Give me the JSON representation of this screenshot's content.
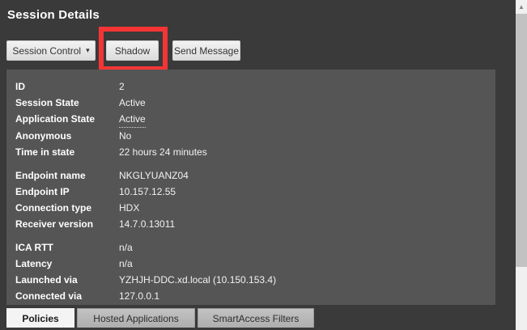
{
  "page": {
    "title": "Session Details"
  },
  "toolbar": {
    "session_control_label": "Session Control",
    "session_control_caret": "▾",
    "shadow_label": "Shadow",
    "send_message_label": "Send Message"
  },
  "annotation": {
    "shape": "red-highlight-rectangle",
    "color": "#f53535",
    "target": "shadow-button"
  },
  "details": {
    "groups": [
      {
        "rows": [
          {
            "label": "ID",
            "value": "2"
          },
          {
            "label": "Session State",
            "value": "Active"
          },
          {
            "label": "Application State",
            "value": "Active",
            "underlined": true
          },
          {
            "label": "Anonymous",
            "value": "No"
          },
          {
            "label": "Time in state",
            "value": "22 hours 24 minutes"
          }
        ]
      },
      {
        "rows": [
          {
            "label": "Endpoint name",
            "value": "NKGLYUANZ04"
          },
          {
            "label": "Endpoint IP",
            "value": "10.157.12.55"
          },
          {
            "label": "Connection type",
            "value": "HDX"
          },
          {
            "label": "Receiver version",
            "value": "14.7.0.13011"
          }
        ]
      },
      {
        "rows": [
          {
            "label": "ICA RTT",
            "value": "n/a"
          },
          {
            "label": "Latency",
            "value": "n/a"
          },
          {
            "label": "Launched via",
            "value": "YZHJH-DDC.xd.local (10.150.153.4)"
          },
          {
            "label": "Connected via",
            "value": "127.0.0.1"
          }
        ]
      }
    ]
  },
  "tabs": [
    {
      "label": "Policies",
      "active": true
    },
    {
      "label": "Hosted Applications",
      "active": false
    },
    {
      "label": "SmartAccess Filters",
      "active": false
    }
  ],
  "scrollbar": {
    "up_arrow": "▲"
  },
  "colors": {
    "outer_background": "#3a3a3a",
    "panel_background": "#555555",
    "button_background": "#e8e8e8",
    "annotation_red": "#f53535",
    "active_tab": "#f4f4f4",
    "inactive_tab": "#b8b8b8",
    "scroll_track": "#f0f0f0",
    "scroll_thumb": "#c2c2c2"
  }
}
